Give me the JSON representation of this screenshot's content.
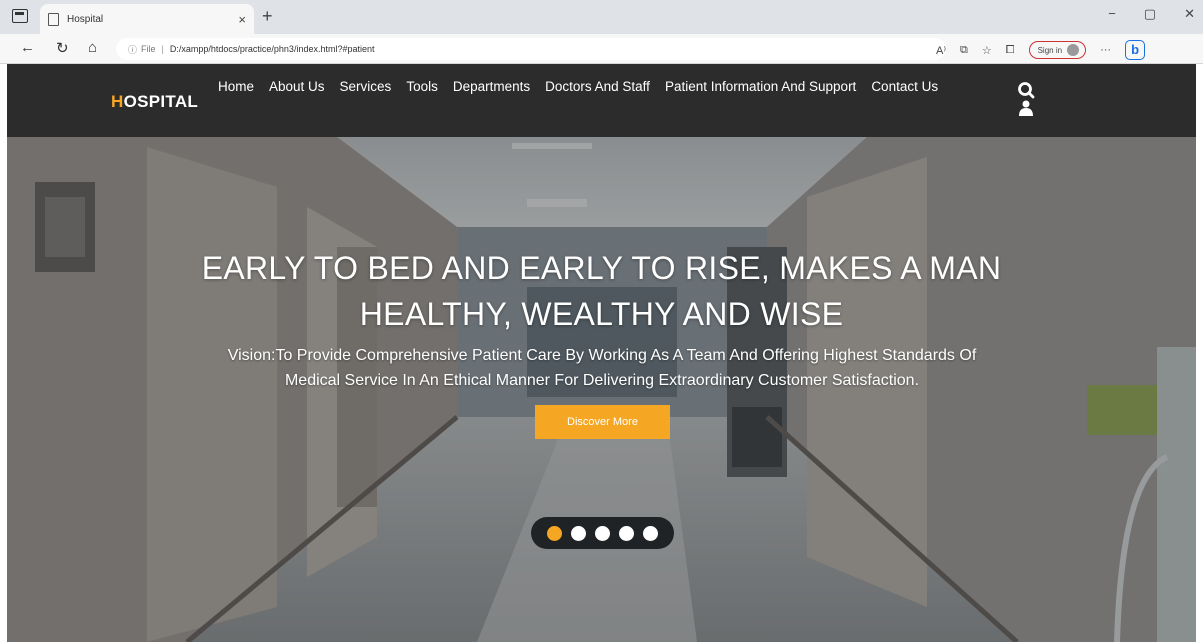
{
  "browser": {
    "tab_title": "Hospital",
    "tab_close": "×",
    "new_tab": "+",
    "url_info": "ⓘ",
    "url_scheme": "File",
    "url_separator": "|",
    "url_path": "D:/xampp/htdocs/practice/phn3/index.html?#patient",
    "sign_in": "Sign in",
    "more": "···",
    "bing": "b",
    "window_controls": [
      "−",
      "▢",
      "✕"
    ]
  },
  "header": {
    "logo_first": "H",
    "logo_rest": "OSPITAL",
    "nav": [
      "Home",
      "About Us",
      "Services",
      "Tools",
      "Departments",
      "Doctors And Staff",
      "Patient Information And Support",
      "Contact Us"
    ]
  },
  "hero": {
    "title_line1": "EARLY TO BED AND EARLY TO RISE, MAKES A MAN",
    "title_line2": "HEALTHY, WEALTHY AND WISE",
    "subtitle_line1": "Vision:To Provide Comprehensive Patient Care By Working As A Team And Offering Highest Standards Of",
    "subtitle_line2": "Medical Service In An Ethical Manner For Delivering Extraordinary Customer Satisfaction.",
    "button_label": "Discover More",
    "slide_count": 5,
    "active_slide": 1
  },
  "colors": {
    "accent": "#f5a623",
    "header_bg": "#2c2c2c",
    "dots_bg": "#1f2326"
  }
}
